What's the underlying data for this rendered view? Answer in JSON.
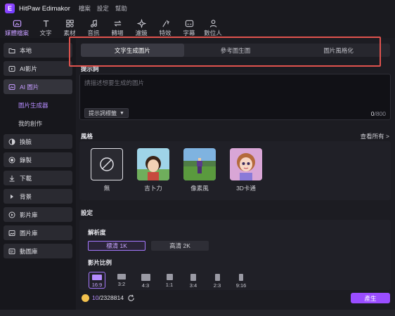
{
  "app": {
    "name": "HitPaw Edimakor",
    "menu": [
      "檔案",
      "設定",
      "幫助"
    ]
  },
  "tool_tabs": [
    {
      "label": "媒體檔案",
      "icon": "media-icon",
      "active": true
    },
    {
      "label": "文字",
      "icon": "text-icon"
    },
    {
      "label": "素材",
      "icon": "assets-icon"
    },
    {
      "label": "音訊",
      "icon": "audio-icon"
    },
    {
      "label": "轉場",
      "icon": "transition-icon"
    },
    {
      "label": "濾鏡",
      "icon": "filter-icon"
    },
    {
      "label": "特效",
      "icon": "effects-icon"
    },
    {
      "label": "字幕",
      "icon": "subtitle-icon"
    },
    {
      "label": "數位人",
      "icon": "avatar-icon"
    }
  ],
  "sidebar": {
    "items": [
      {
        "label": "本地",
        "icon": "folder-icon"
      },
      {
        "label": "AI影片",
        "icon": "ai-video-icon"
      },
      {
        "label": "AI 圖片",
        "icon": "ai-image-icon",
        "active": true
      },
      {
        "label": "換臉",
        "icon": "face-swap-icon"
      },
      {
        "label": "錄製",
        "icon": "record-icon"
      },
      {
        "label": "下載",
        "icon": "download-icon"
      },
      {
        "label": "背景",
        "icon": "background-icon"
      },
      {
        "label": "影片庫",
        "icon": "video-library-icon"
      },
      {
        "label": "圖片庫",
        "icon": "image-library-icon"
      },
      {
        "label": "動圖庫",
        "icon": "gif-library-icon"
      }
    ],
    "sub_items": [
      {
        "label": "圖片生成器",
        "active": true
      },
      {
        "label": "我的創作"
      }
    ]
  },
  "mode_tabs": [
    {
      "label": "文字生成圖片",
      "active": true
    },
    {
      "label": "參考圖生圖"
    },
    {
      "label": "圖片風格化"
    }
  ],
  "prompt": {
    "title": "提示詞",
    "placeholder": "請描述想要生成的圖片",
    "tag_button": "提示詞標籤",
    "count_current": "0",
    "count_max": "/800"
  },
  "style": {
    "title": "風格",
    "view_all": "查看所有 >",
    "options": [
      {
        "label": "無",
        "selected": true
      },
      {
        "label": "吉卜力"
      },
      {
        "label": "像素風"
      },
      {
        "label": "3D卡通"
      }
    ]
  },
  "settings": {
    "title": "設定",
    "resolution_title": "解析度",
    "resolutions": [
      {
        "label": "標清 1K",
        "active": true
      },
      {
        "label": "高清 2K"
      }
    ],
    "ratio_title": "影片比例",
    "ratios": [
      "16:9",
      "3:2",
      "4:3",
      "1:1",
      "3:4",
      "2:3",
      "9:16"
    ],
    "ratio_selected": "16:9"
  },
  "footer": {
    "credits_used": "10",
    "credits_total": "/2328814",
    "generate_label": "產生"
  },
  "colors": {
    "accent": "#9a4dff",
    "highlight_border": "#e0534e",
    "background": "#1c1c22"
  }
}
